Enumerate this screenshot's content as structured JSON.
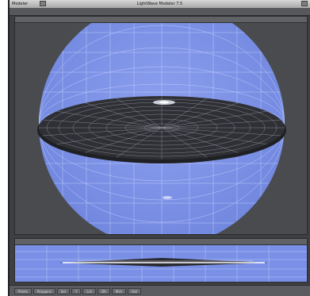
{
  "window": {
    "app_menu": "Modeler",
    "title": "LightWave Modeler 7.5"
  },
  "toolbar": {},
  "viewports": [
    {
      "name": "perspective"
    },
    {
      "name": "side"
    }
  ],
  "statusbar": {
    "buttons": [
      "Points",
      "Polygons",
      "Sel",
      "Y",
      "Lck",
      "Dlt",
      "Msh",
      "Get"
    ]
  },
  "colors": {
    "sphere": "#7a90e6",
    "disc": "#2f3035",
    "background": "#4a4b4f",
    "wire": "#c9d4ff"
  }
}
